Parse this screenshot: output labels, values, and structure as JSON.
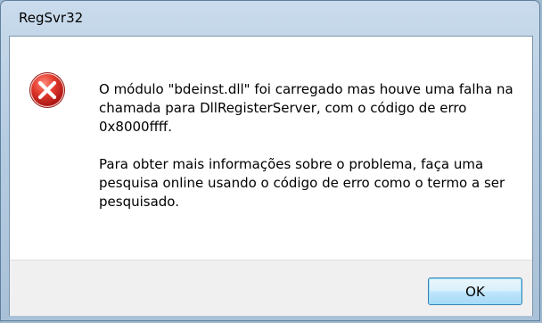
{
  "window": {
    "title": "RegSvr32"
  },
  "message": {
    "paragraph1": "O módulo \"bdeinst.dll\" foi carregado mas houve uma falha na chamada para DllRegisterServer, com o código de erro 0x8000ffff.",
    "paragraph2": "Para obter mais informações sobre o problema, faça uma pesquisa online usando o código de erro como o termo a ser pesquisado."
  },
  "buttons": {
    "ok_label": "OK"
  },
  "icons": {
    "status": "error-icon"
  },
  "colors": {
    "error_red": "#d2302f",
    "button_border": "#3c7fb1"
  }
}
